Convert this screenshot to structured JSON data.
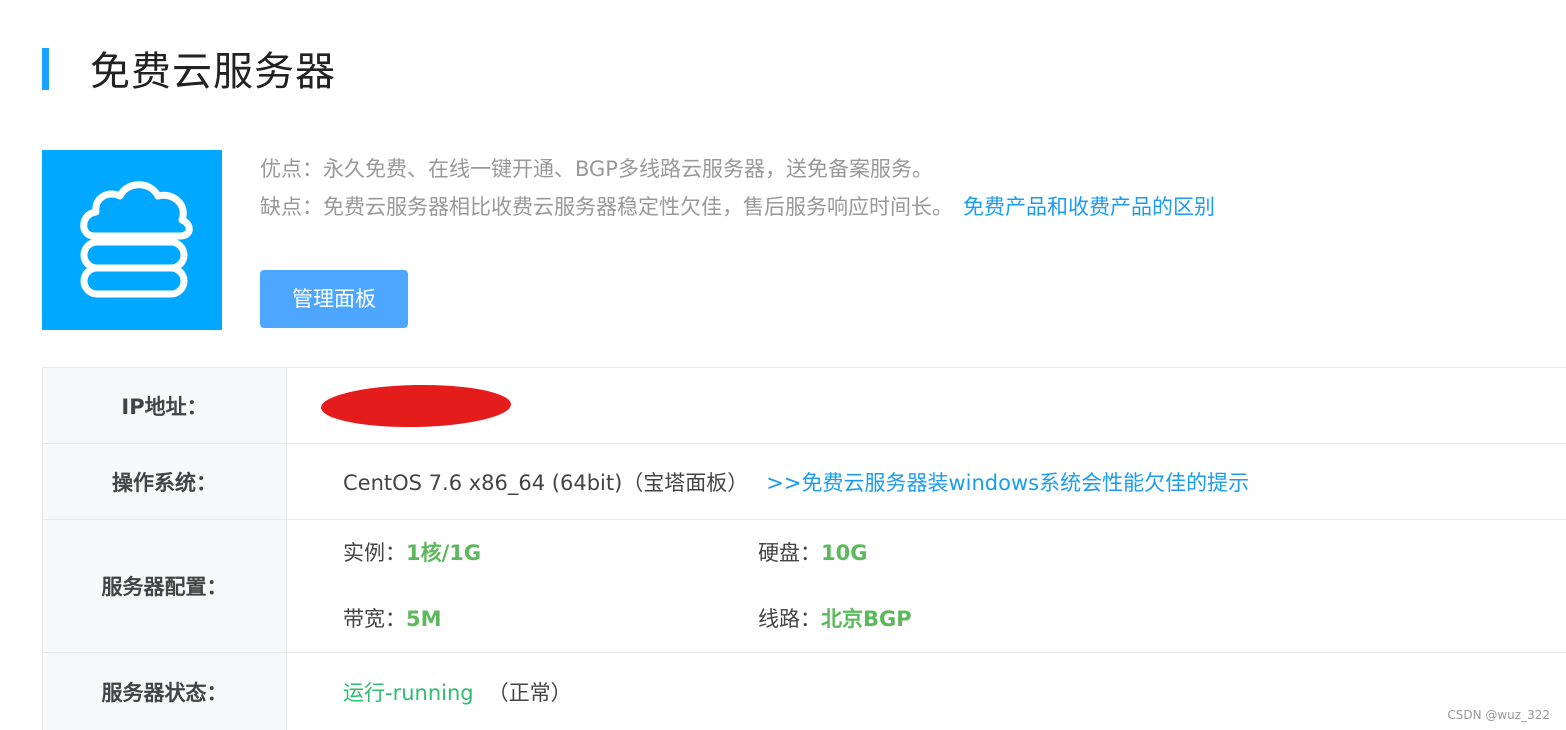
{
  "header": {
    "title": "免费云服务器"
  },
  "product": {
    "icon": "cloud-server-icon",
    "accent_color": "#00a8ff",
    "pros": "优点：永久免费、在线一键开通、BGP多线路云服务器，送免备案服务。",
    "cons": "缺点：免费云服务器相比收费云服务器稳定性欠佳，售后服务响应时间长。",
    "compare_link": "免费产品和收费产品的区别",
    "manage_button": "管理面板"
  },
  "table": {
    "ip": {
      "label": "IP地址："
    },
    "os": {
      "label": "操作系统：",
      "value": "CentOS 7.6 x86_64 (64bit)（宝塔面板）",
      "link": ">>免费云服务器装windows系统会性能欠佳的提示"
    },
    "config": {
      "label": "服务器配置：",
      "instance_label": "实例：",
      "instance_value": "1核/1G",
      "disk_label": "硬盘：",
      "disk_value": "10G",
      "bandwidth_label": "带宽：",
      "bandwidth_value": "5M",
      "line_label": "线路：",
      "line_value": "北京BGP",
      "value_color": "#5cb85c"
    },
    "status": {
      "label": "服务器状态：",
      "value": "运行-running",
      "note": "（正常）",
      "status_color": "#2dbd6f"
    }
  },
  "watermark": "CSDN @wuz_322"
}
